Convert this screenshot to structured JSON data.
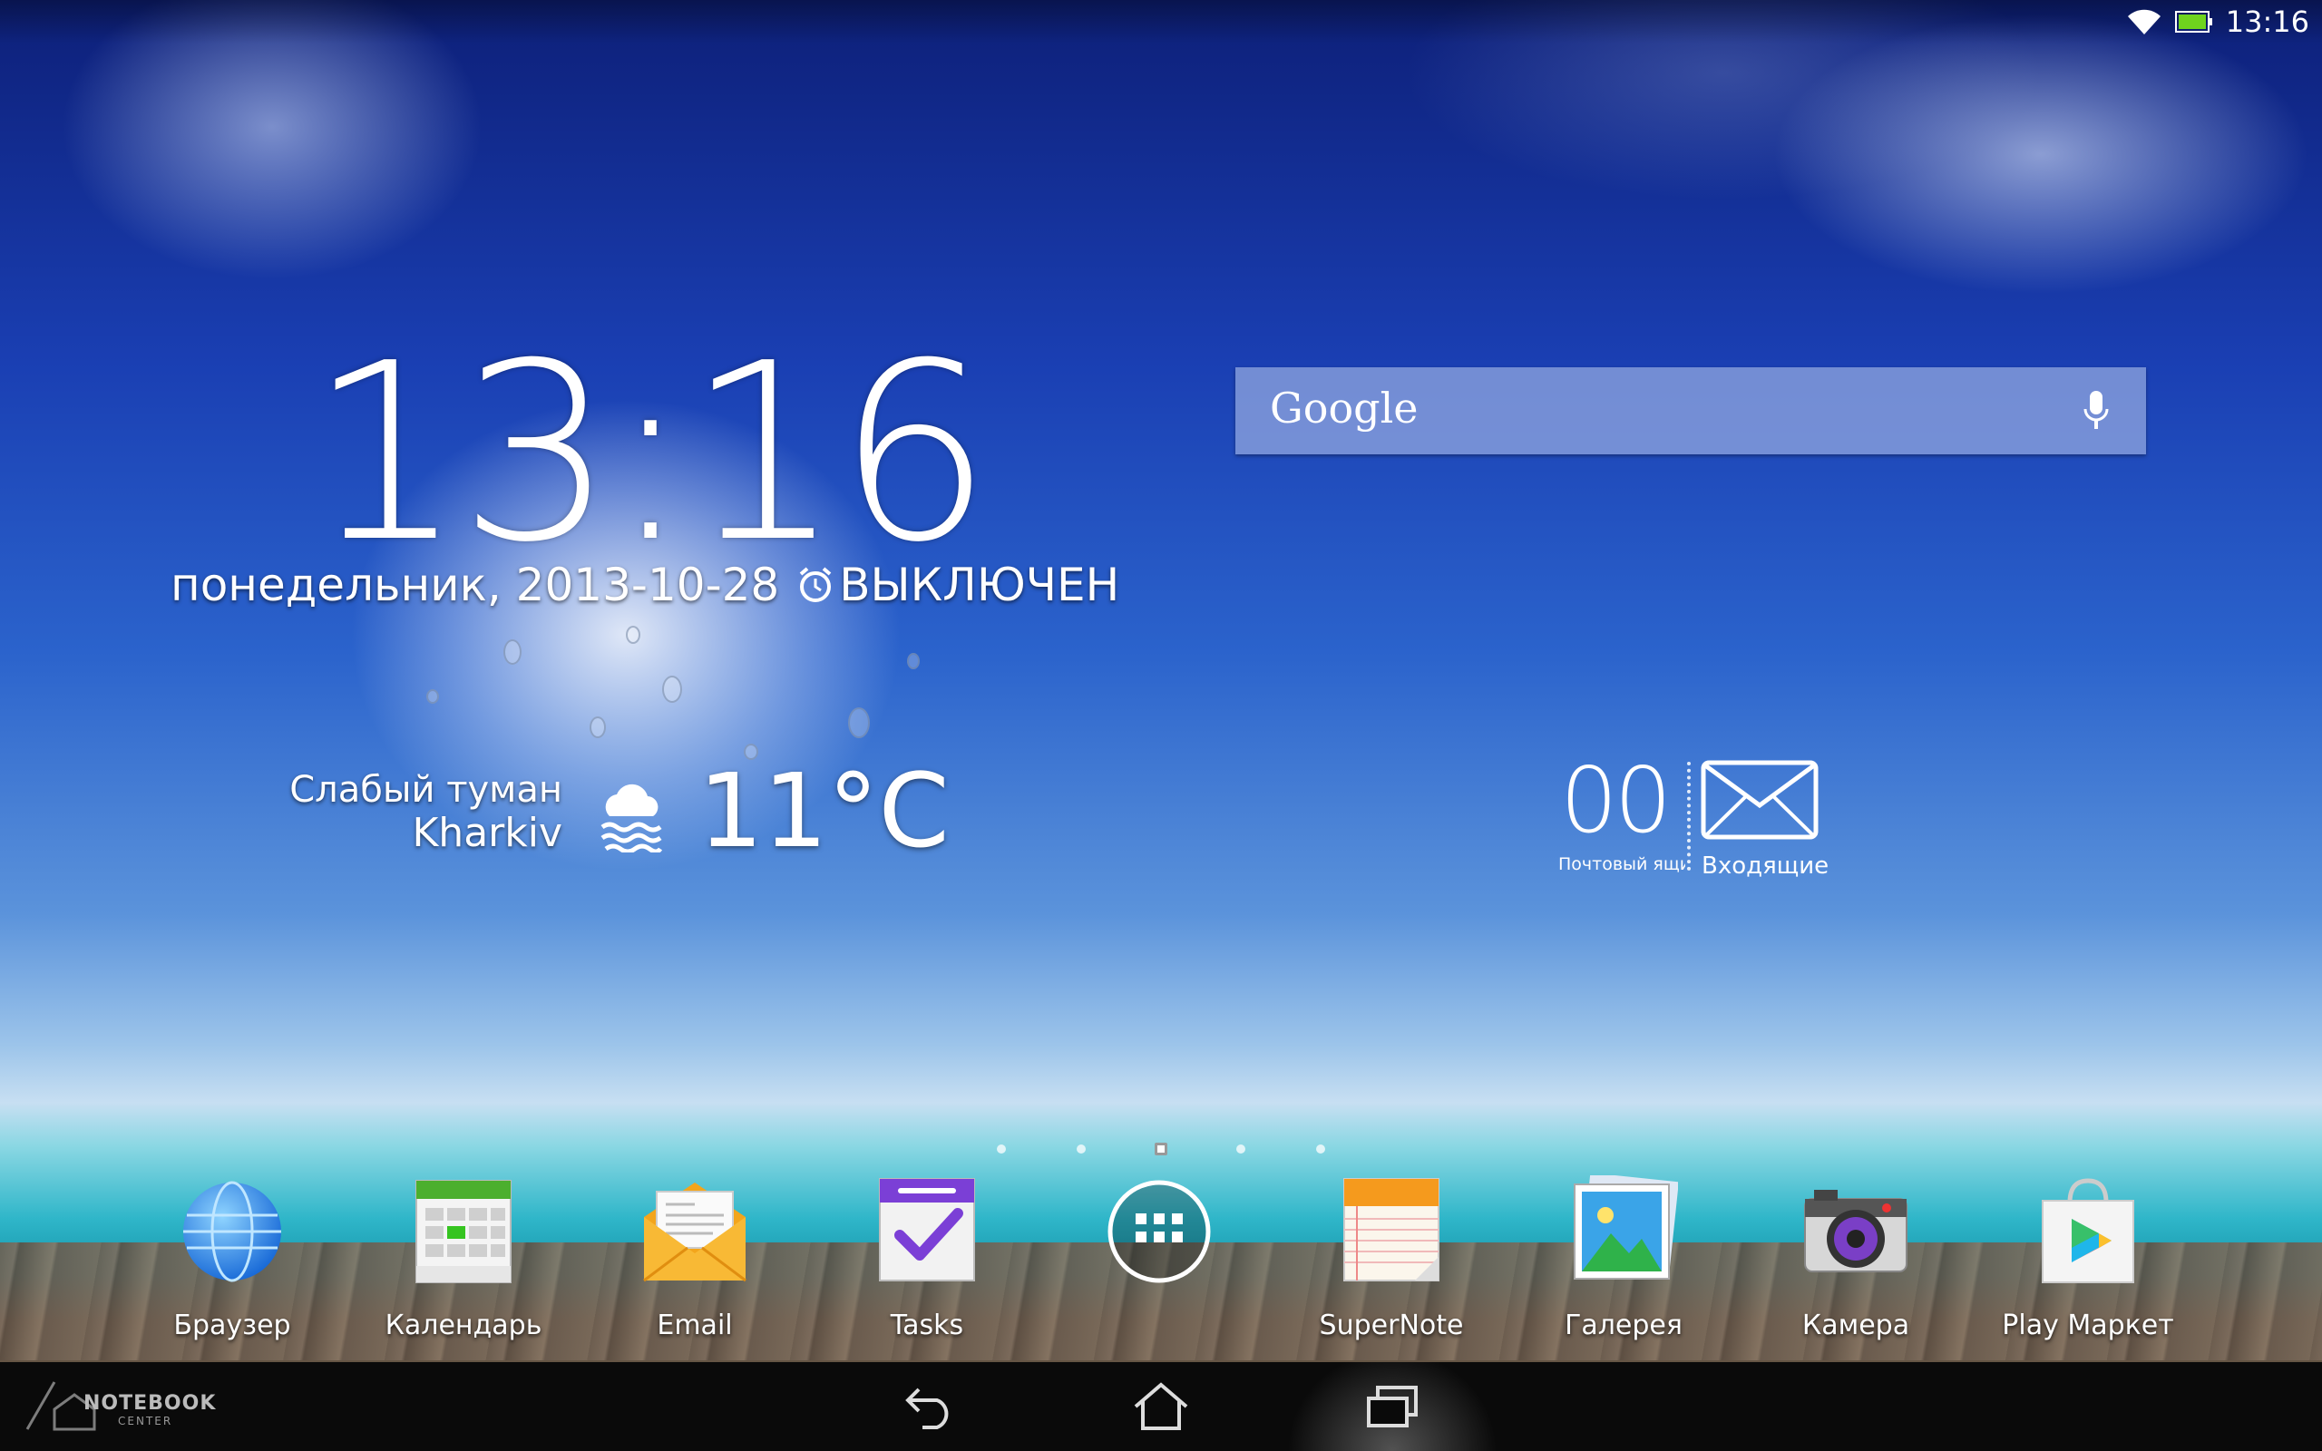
{
  "status_bar": {
    "time": "13:16"
  },
  "clock": {
    "time": "13:16",
    "date": "понедельник, 2013-10-28",
    "alarm": "ВЫКЛЮЧЕН"
  },
  "weather": {
    "condition": "Слабый туман",
    "city": "Kharkiv",
    "temperature": "11°C",
    "icon": "fog-icon"
  },
  "search": {
    "logo": "Google",
    "icon": "mic-icon"
  },
  "mail_widget": {
    "count": "00",
    "mailbox_label": "Почтовый ящи...",
    "folder_label": "Входящие",
    "icon": "envelope-icon"
  },
  "pages": {
    "total": 5,
    "active": 3
  },
  "dock": [
    {
      "label": "Браузер",
      "icon": "browser-globe-icon"
    },
    {
      "label": "Календарь",
      "icon": "calendar-icon"
    },
    {
      "label": "Email",
      "icon": "email-icon"
    },
    {
      "label": "Tasks",
      "icon": "tasks-icon"
    },
    {
      "label": "",
      "icon": "app-drawer-icon"
    },
    {
      "label": "SuperNote",
      "icon": "supernote-icon"
    },
    {
      "label": "Галерея",
      "icon": "gallery-icon"
    },
    {
      "label": "Камера",
      "icon": "camera-icon"
    },
    {
      "label": "Play Маркет",
      "icon": "play-store-icon"
    }
  ],
  "nav": {
    "back": "back-icon",
    "home": "home-icon",
    "recents": "recents-icon"
  },
  "watermark": {
    "text": "NOTEBOOK",
    "sub": "CENTER"
  },
  "colors": {
    "battery": "#6fd31e",
    "search_bar": "#96aae1",
    "nav_bar": "#0a0a0a"
  }
}
